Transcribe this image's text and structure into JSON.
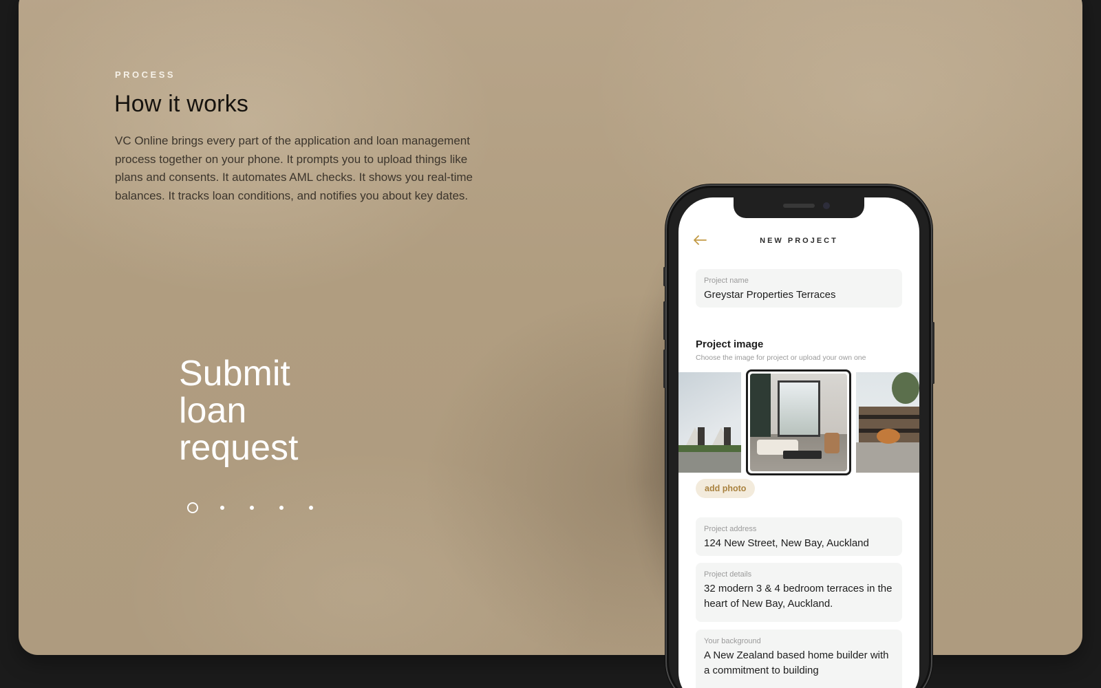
{
  "section": {
    "eyebrow": "PROCESS",
    "heading": "How it works",
    "body": "VC Online brings every part of the application and loan management process together on your phone. It prompts you to upload things like plans and consents. It automates AML checks. It shows you real-time balances. It tracks loan conditions, and notifies you about key dates."
  },
  "step": {
    "title": "Submit loan request",
    "dots_total": 5,
    "active_index": 0
  },
  "phone": {
    "title": "NEW PROJECT",
    "back_icon": "arrow-left-icon",
    "accent_color": "#c29a45",
    "project_name": {
      "label": "Project name",
      "value": "Greystar Properties Terraces"
    },
    "project_image": {
      "title": "Project image",
      "subtitle": "Choose the image for project or upload your own one",
      "selected_index": 1,
      "add_label": "add photo"
    },
    "project_address": {
      "label": "Project address",
      "value": "124 New Street, New Bay, Auckland"
    },
    "project_details": {
      "label": "Project details",
      "value": "32 modern 3 & 4 bedroom terraces in the heart of New Bay, Auckland."
    },
    "your_background": {
      "label": "Your background",
      "value": "A New Zealand based home builder with a commitment to building"
    }
  },
  "colors": {
    "panel": "#b4a185",
    "page_bg": "#1b1b1b",
    "heading_text": "#16130f",
    "step_text": "#ffffff"
  }
}
